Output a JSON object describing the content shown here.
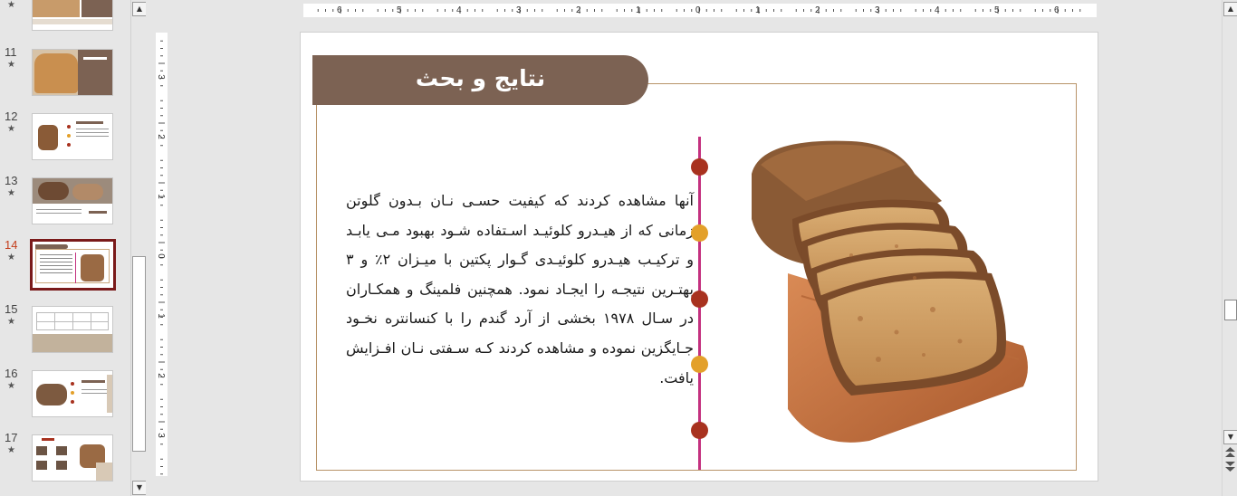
{
  "thumbnails": {
    "items": [
      {
        "number": "",
        "star": "★"
      },
      {
        "number": "11",
        "star": "★"
      },
      {
        "number": "12",
        "star": "★"
      },
      {
        "number": "13",
        "star": "★"
      },
      {
        "number": "14",
        "star": "★"
      },
      {
        "number": "15",
        "star": "★"
      },
      {
        "number": "16",
        "star": "★"
      },
      {
        "number": "17",
        "star": "★"
      }
    ],
    "selected_number": "14"
  },
  "scroll_arrows": {
    "up": "▲",
    "down": "▼"
  },
  "ruler": {
    "horizontal": [
      "6",
      "5",
      "4",
      "3",
      "2",
      "1",
      "0",
      "1",
      "2",
      "3",
      "4",
      "5",
      "6"
    ],
    "vertical": [
      "3",
      "2",
      "1",
      "0",
      "1",
      "2",
      "3"
    ]
  },
  "slide": {
    "title": "نتایج و بحث",
    "body": "آنها مشاهده کردند که کیفیت حسـی نـان بـدون گلوتن زمانی که از هیـدرو کلوئیـد اسـتفاده شـود بهبود مـی یابـد و ترکیـب هیـدرو کلوئیـدی گـوار پکتین با میـزان ۲٪ و ۳ بهتـرین نتیجـه را ایجـاد نمود. همچنین فلمینگ و همکـاران در سـال ۱۹۷۸ بخشی از آرد گندم را با کنسانتره نخـود جـایگزین نموده و مشاهده کردند کـه سـفتی نـان افـزایش یافت.",
    "timeline_dot_colors": [
      "#a8321f",
      "#e3a02a",
      "#a8321f",
      "#e3a02a",
      "#a8321f"
    ],
    "accent_colors": {
      "title_banner": "#7c6253",
      "frame": "#b89368",
      "timeline": "#c4317f"
    },
    "image": "bread-loaf-sliced-on-board"
  }
}
